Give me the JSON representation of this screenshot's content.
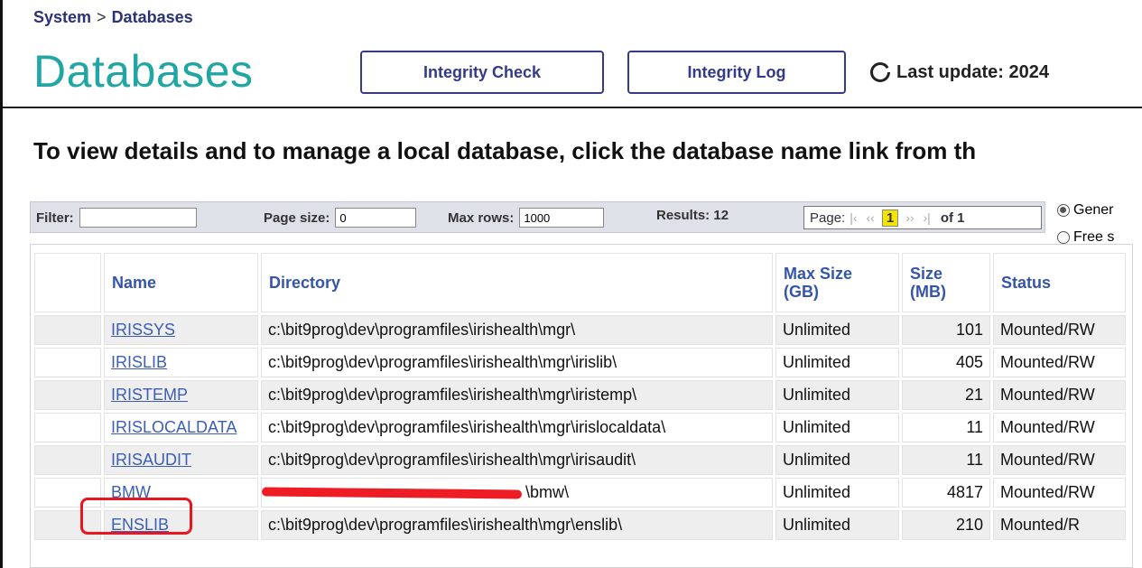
{
  "breadcrumb": {
    "parent": "System",
    "separator": ">",
    "current": "Databases"
  },
  "page_title": "Databases",
  "toolbar": {
    "integrity_check": "Integrity Check",
    "integrity_log": "Integrity Log"
  },
  "last_update": "Last update: 2024",
  "instructions": "To view details and to manage a local database, click the database name link from th",
  "filter_bar": {
    "filter_label": "Filter:",
    "filter_value": "",
    "page_size_label": "Page size:",
    "page_size_value": "0",
    "max_rows_label": "Max rows:",
    "max_rows_value": "1000",
    "results_label": "Results: 12",
    "page_label": "Page:",
    "current_page": "1",
    "of_label": "of 1"
  },
  "view_options": [
    {
      "label": "Gener",
      "selected": true
    },
    {
      "label": "Free s",
      "selected": false
    }
  ],
  "table": {
    "headers": [
      "Name",
      "Directory",
      "Max Size (GB)",
      "Size (MB)",
      "Status"
    ],
    "rows": [
      {
        "name": "IRISSYS",
        "directory": "c:\\bit9prog\\dev\\programfiles\\irishealth\\mgr\\",
        "max_size": "Unlimited",
        "size": "101",
        "status": "Mounted/RW"
      },
      {
        "name": "IRISLIB",
        "directory": "c:\\bit9prog\\dev\\programfiles\\irishealth\\mgr\\irislib\\",
        "max_size": "Unlimited",
        "size": "405",
        "status": "Mounted/RW"
      },
      {
        "name": "IRISTEMP",
        "directory": "c:\\bit9prog\\dev\\programfiles\\irishealth\\mgr\\iristemp\\",
        "max_size": "Unlimited",
        "size": "21",
        "status": "Mounted/RW"
      },
      {
        "name": "IRISLOCALDATA",
        "directory": "c:\\bit9prog\\dev\\programfiles\\irishealth\\mgr\\irislocaldata\\",
        "max_size": "Unlimited",
        "size": "11",
        "status": "Mounted/RW"
      },
      {
        "name": "IRISAUDIT",
        "directory": "c:\\bit9prog\\dev\\programfiles\\irishealth\\mgr\\irisaudit\\",
        "max_size": "Unlimited",
        "size": "11",
        "status": "Mounted/RW"
      },
      {
        "name": "BMW",
        "directory": "\\bmw\\",
        "directory_redacted": true,
        "max_size": "Unlimited",
        "size": "4817",
        "status": "Mounted/RW"
      },
      {
        "name": "ENSLIB",
        "directory": "c:\\bit9prog\\dev\\programfiles\\irishealth\\mgr\\enslib\\",
        "max_size": "Unlimited",
        "size": "210",
        "status": "Mounted/R"
      }
    ]
  },
  "colors": {
    "title": "#21a6a4",
    "link": "#3a5fb5",
    "button_border": "#333a88",
    "highlight": "#e8171f",
    "pager_current": "#f5e400"
  },
  "icons": {
    "refresh": "refresh-icon"
  }
}
